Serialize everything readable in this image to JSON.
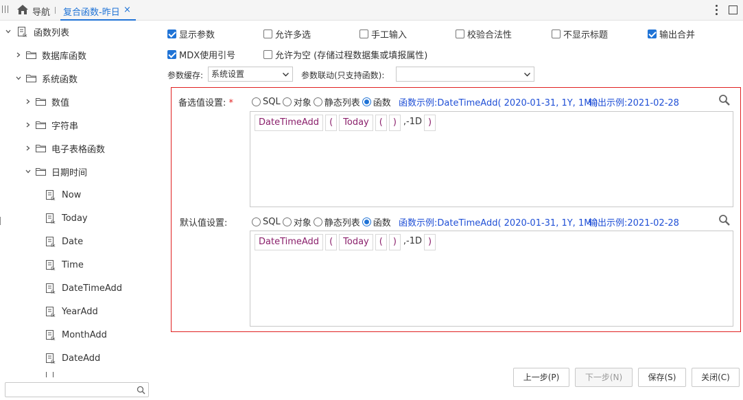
{
  "topbar": {
    "nav_label": "导航",
    "tab_label": "复合函数-昨日",
    "tab_close": "×"
  },
  "sidebar": {
    "root_label": "函数列表",
    "items": [
      {
        "label": "数据库函数"
      },
      {
        "label": "系统函数"
      },
      {
        "label": "数值"
      },
      {
        "label": "字符串"
      },
      {
        "label": "电子表格函数"
      },
      {
        "label": "日期时间"
      },
      {
        "label": "Now"
      },
      {
        "label": "Today"
      },
      {
        "label": "Date"
      },
      {
        "label": "Time"
      },
      {
        "label": "DateTimeAdd"
      },
      {
        "label": "YearAdd"
      },
      {
        "label": "MonthAdd"
      },
      {
        "label": "DateAdd"
      }
    ],
    "search_placeholder": ""
  },
  "options": {
    "show_param": "显示参数",
    "allow_multi": "允许多选",
    "manual_input": "手工输入",
    "validate": "校验合法性",
    "hide_title": "不显示标题",
    "merge_output": "输出合并",
    "mdx_quote": "MDX使用引号",
    "allow_empty": "允许为空 (存储过程数据集或填报属性)",
    "checked": {
      "show_param": true,
      "allow_multi": false,
      "manual_input": false,
      "validate": false,
      "hide_title": false,
      "merge_output": true,
      "mdx_quote": true,
      "allow_empty": false
    }
  },
  "cache": {
    "label": "参数缓存:",
    "value": "系统设置"
  },
  "linkage": {
    "label": "参数联动(只支持函数):",
    "value": ""
  },
  "candidate": {
    "label": "备选值设置:",
    "required_mark": "*",
    "radio_options": [
      "SQL",
      "对象",
      "静态列表",
      "函数"
    ],
    "selected": "函数",
    "example_label": "函数示例:",
    "example_value": "DateTimeAdd( 2020-01-31, 1Y, 1M )",
    "output_label": "输出示例:",
    "output_value": "2021-02-28",
    "tokens": [
      "DateTimeAdd",
      "(",
      "Today",
      "(",
      ")",
      ",-1D",
      ")"
    ]
  },
  "default": {
    "label": "默认值设置:",
    "radio_options": [
      "SQL",
      "对象",
      "静态列表",
      "函数"
    ],
    "selected": "函数",
    "example_label": "函数示例:",
    "example_value": "DateTimeAdd( 2020-01-31, 1Y, 1M )",
    "output_label": "输出示例:",
    "output_value": "2021-02-28",
    "tokens": [
      "DateTimeAdd",
      "(",
      "Today",
      "(",
      ")",
      ",-1D",
      ")"
    ]
  },
  "buttons": {
    "prev": "上一步(P)",
    "next": "下一步(N)",
    "save": "保存(S)",
    "close": "关闭(C)"
  },
  "colors": {
    "accent": "#1f73d6",
    "frame": "#e02020",
    "token_text": "#8a1f6b",
    "example_text": "#1f4fd6"
  }
}
